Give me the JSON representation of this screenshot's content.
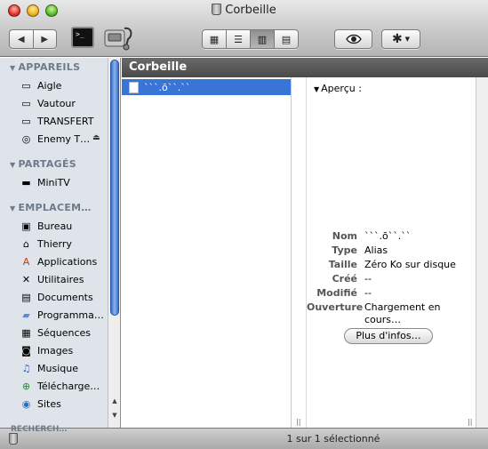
{
  "window": {
    "title": "Corbeille",
    "title_icon": "trash-icon"
  },
  "toolbar": {
    "back_glyph": "◀",
    "forward_glyph": "▶",
    "view_glyphs": [
      "▦",
      "☰",
      "▥",
      "▤"
    ],
    "active_view_index": 2,
    "quicklook_icon": "eye-icon",
    "action_glyph": "✱",
    "action_caret": "▼"
  },
  "sidebar": {
    "sections": [
      {
        "label": "APPAREILS",
        "items": [
          {
            "label": "Aigle",
            "icon": "harddisk-icon"
          },
          {
            "label": "Vautour",
            "icon": "harddisk-icon"
          },
          {
            "label": "TRANSFERT",
            "icon": "harddisk-icon"
          },
          {
            "label": "Enemy T…",
            "icon": "cd-icon",
            "eject": "⏏"
          }
        ]
      },
      {
        "label": "PARTAGÉS",
        "items": [
          {
            "label": "MiniTV",
            "icon": "mac-mini-icon"
          }
        ]
      },
      {
        "label": "EMPLACEM…",
        "items": [
          {
            "label": "Bureau",
            "icon": "desktop-icon"
          },
          {
            "label": "Thierry",
            "icon": "home-icon"
          },
          {
            "label": "Applications",
            "icon": "applications-icon"
          },
          {
            "label": "Utilitaires",
            "icon": "utilities-icon"
          },
          {
            "label": "Documents",
            "icon": "documents-icon"
          },
          {
            "label": "Programmat…",
            "icon": "folder-icon"
          },
          {
            "label": "Séquences",
            "icon": "movies-icon"
          },
          {
            "label": "Images",
            "icon": "pictures-icon"
          },
          {
            "label": "Musique",
            "icon": "music-icon"
          },
          {
            "label": "Télécharge…",
            "icon": "downloads-icon"
          },
          {
            "label": "Sites",
            "icon": "sites-icon"
          }
        ]
      },
      {
        "label": "RECHERCH…"
      }
    ]
  },
  "main": {
    "header_title": "Corbeille",
    "selected_file": "ˋˋˋ.ōˋˋ.ˋˋ"
  },
  "preview": {
    "heading": "Aperçu :",
    "rows": [
      {
        "key": "Nom",
        "value": "ˋˋˋ.ōˋˋ.ˋˋ"
      },
      {
        "key": "Type",
        "value": "Alias"
      },
      {
        "key": "Taille",
        "value": "Zéro Ko sur disque"
      },
      {
        "key": "Créé",
        "value": "--"
      },
      {
        "key": "Modifié",
        "value": "--"
      },
      {
        "key": "Ouverture",
        "value": "Chargement en cours…"
      }
    ],
    "more_info_label": "Plus d'infos…"
  },
  "statusbar": {
    "text": "1 sur 1 sélectionné"
  }
}
